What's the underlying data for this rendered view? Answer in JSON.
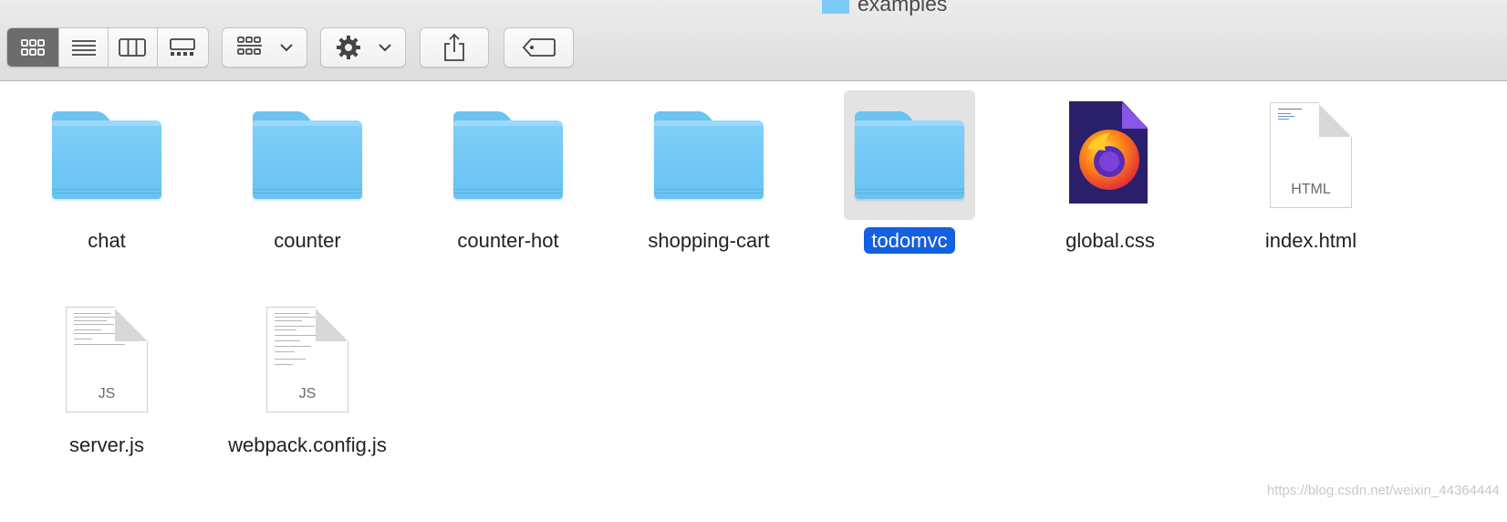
{
  "window": {
    "title": "examples"
  },
  "toolbar": {
    "view_modes": [
      {
        "name": "icon-view-icon",
        "active": true
      },
      {
        "name": "list-view-icon",
        "active": false
      },
      {
        "name": "column-view-icon",
        "active": false
      },
      {
        "name": "gallery-view-icon",
        "active": false
      }
    ],
    "group_icon": "group-by-icon",
    "action_icon": "gear-icon",
    "share_icon": "share-icon",
    "tag_icon": "tag-icon"
  },
  "items": [
    {
      "name": "chat",
      "type": "folder",
      "selected": false
    },
    {
      "name": "counter",
      "type": "folder",
      "selected": false
    },
    {
      "name": "counter-hot",
      "type": "folder",
      "selected": false
    },
    {
      "name": "shopping-cart",
      "type": "folder",
      "selected": false
    },
    {
      "name": "todomvc",
      "type": "folder",
      "selected": true
    },
    {
      "name": "global.css",
      "type": "firefox-doc",
      "selected": false
    },
    {
      "name": "index.html",
      "type": "doc",
      "kind": "HTML",
      "selected": false
    },
    {
      "name": "server.js",
      "type": "doc",
      "kind": "JS",
      "selected": false
    },
    {
      "name": "webpack.config.js",
      "type": "doc",
      "kind": "JS",
      "selected": false
    }
  ],
  "watermark": "https://blog.csdn.net/weixin_44364444",
  "colors": {
    "selection": "#1560e0",
    "folder": "#6cc2f1"
  }
}
